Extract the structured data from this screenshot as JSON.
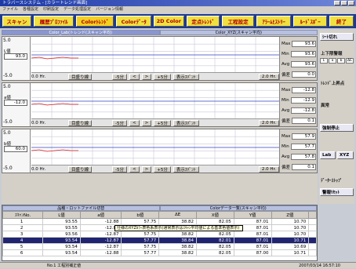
{
  "window": {
    "title": "トラバースシステム - [カラートレンド画面]"
  },
  "menu": [
    "ファイル",
    "各種設定",
    "印刷設定",
    "データ処理設定",
    "バージョン情報"
  ],
  "toolbar": [
    {
      "label": "スキャン"
    },
    {
      "label": "履歴ﾌﾟﾛﾌｧｲﾙ"
    },
    {
      "label": "Colorﾄﾚﾝﾄﾞ",
      "selected": true
    },
    {
      "label": "Colorﾃﾞｰﾀ"
    },
    {
      "label": "2D Color"
    },
    {
      "label": "定点ﾄﾚﾝﾄﾞ"
    },
    {
      "label": "工程設定"
    },
    {
      "label": "ｱﾗｰﾑﾋｽﾄﾘｰ"
    },
    {
      "label": "ﾙｰﾄﾞｽﾎﾟｰ"
    },
    {
      "label": "終了"
    }
  ],
  "panel_tabs": [
    "Color_Lab(トレンド(スキャン平均)",
    "Color_XYZ(スキャン平均)"
  ],
  "charts": [
    {
      "ymax": "5.0",
      "name": "L値",
      "value": "93.0",
      "ymin": "-5.0",
      "time_left": "0.0 Hr.",
      "time_right": "2.0 Hr.",
      "stats": [
        [
          "Max",
          "93.6"
        ],
        [
          "Min",
          "93.6"
        ],
        [
          "Avg",
          "93.6"
        ],
        [
          "偏差",
          "0.0"
        ]
      ]
    },
    {
      "ymax": "5.0",
      "name": "a値",
      "value": "-12.0",
      "ymin": "-5.0",
      "time_left": "0.0 Hr.",
      "time_right": "2.0 Hr.",
      "stats": [
        [
          "Max",
          "-12.8"
        ],
        [
          "Min",
          "-12.9"
        ],
        [
          "Avg",
          "-12.8"
        ],
        [
          "偏差",
          "0.1"
        ]
      ]
    },
    {
      "ymax": "5.0",
      "name": "b値",
      "value": "60.0",
      "ymin": "-5.0",
      "time_left": "0.0 Hr.",
      "time_right": "2.0 Hr.",
      "stats": [
        [
          "Max",
          "57.9"
        ],
        [
          "Min",
          "57.7"
        ],
        [
          "Avg",
          "57.8"
        ],
        [
          "偏差",
          "0.1"
        ]
      ]
    }
  ],
  "chart_controls": {
    "grid_btn": "目盛り線",
    "minus": "-5分",
    "prev": "<",
    "next": ">",
    "plus": "+5分",
    "display_range": "表示ｽﾊﾟﾝﾄ"
  },
  "right_panel": {
    "section1": "ｼｰﾄ切れ",
    "section2": "上下限警報",
    "grid_labels": [
      "L",
      "a",
      "b",
      "ΔE"
    ],
    "section3": "ﾄﾚﾝﾄﾞ上昇点",
    "section4": "異常",
    "section5": "強制停止",
    "lab_btn": "Lab",
    "xyz_btn": "XYZ",
    "section6": "ﾃﾞｰﾀｰｽﾄｯﾌﾟ",
    "section7": "警報ﾘｾｯﾄ"
  },
  "table_tabs": [
    "品種・ロットファイル切替",
    "Colorデータ一覧(スキャン平均)"
  ],
  "table": {
    "headers": [
      "ｽｷｬﾝNo.",
      "L値",
      "a値",
      "b値",
      "ΔE",
      "X値",
      "Y値",
      "Z値",
      ""
    ],
    "rows": [
      [
        "1",
        "93.55",
        "-12.88",
        "57.75",
        "38.82",
        "82.05",
        "87.01",
        "10.70",
        ""
      ],
      [
        "2",
        "93.55",
        "-12.88",
        "57.75",
        "38.82",
        "82.05",
        "87.01",
        "10.70",
        ""
      ],
      [
        "3",
        "93.56",
        "-12.87",
        "57.75",
        "38.82",
        "82.05",
        "87.01",
        "10.70",
        ""
      ],
      [
        "4",
        "93.54",
        "-12.87",
        "57.77",
        "38.84",
        "82.01",
        "87.01",
        "10.71",
        ""
      ],
      [
        "5",
        "93.54",
        "-12.87",
        "57.75",
        "38.82",
        "82.05",
        "87.01",
        "10.69",
        ""
      ],
      [
        "6",
        "93.54",
        "-12.88",
        "57.77",
        "38.82",
        "82.05",
        "87.00",
        "10.71",
        ""
      ]
    ],
    "highlight_row": 3
  },
  "popup": "仕様のXYZｶﾗｰ表色系表示(通常表示はｽｷｬﾝ平均値による基準色値表示)",
  "status": {
    "left": "No.1  工程別補正値",
    "right": "2007/03/14 16:57:10"
  }
}
